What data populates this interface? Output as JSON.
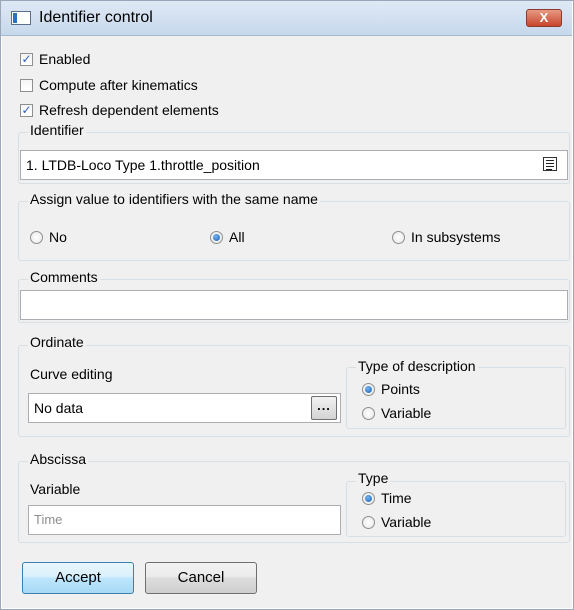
{
  "window": {
    "title": "Identifier control",
    "close_symbol": "X"
  },
  "options": {
    "enabled": {
      "label": "Enabled",
      "checked": true
    },
    "compute_after_kinematics": {
      "label": "Compute after kinematics",
      "checked": false
    },
    "refresh_dependent": {
      "label": "Refresh dependent elements",
      "checked": true
    }
  },
  "identifier": {
    "group_title": "Identifier",
    "value": "1. LTDB-Loco Type 1.throttle_position",
    "list_icon": "list-icon"
  },
  "assign": {
    "group_title": "Assign value to identifiers with the same name",
    "options": [
      {
        "label": "No",
        "selected": false
      },
      {
        "label": "All",
        "selected": true
      },
      {
        "label": "In subsystems",
        "selected": false
      }
    ]
  },
  "comments": {
    "group_title": "Comments",
    "value": ""
  },
  "ordinate": {
    "group_title": "Ordinate",
    "curve_editing_label": "Curve editing",
    "curve_value": "No data",
    "ellipsis": "...",
    "type_title": "Type of description",
    "type_options": [
      {
        "label": "Points",
        "selected": true
      },
      {
        "label": "Variable",
        "selected": false
      }
    ]
  },
  "abscissa": {
    "group_title": "Abscissa",
    "variable_label": "Variable",
    "variable_placeholder": "Time",
    "type_title": "Type",
    "type_options": [
      {
        "label": "Time",
        "selected": true
      },
      {
        "label": "Variable",
        "selected": false
      }
    ]
  },
  "buttons": {
    "accept": "Accept",
    "cancel": "Cancel"
  }
}
